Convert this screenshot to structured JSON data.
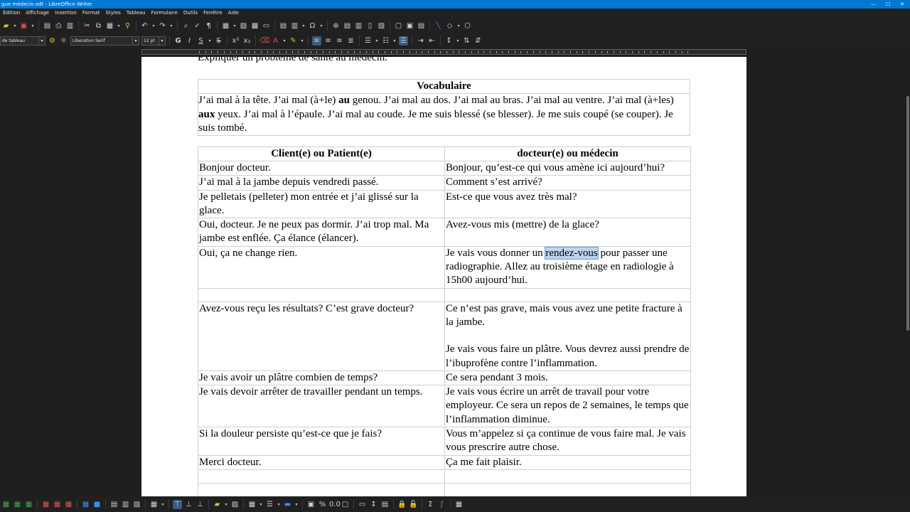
{
  "window": {
    "title": "gue médecin.odt - LibreOffice Writer",
    "controls": [
      "—",
      "☐",
      "✕"
    ]
  },
  "menu": [
    "Édition",
    "Affichage",
    "Insertion",
    "Format",
    "Styles",
    "Tableau",
    "Formulaire",
    "Outils",
    "Fenêtre",
    "Aide"
  ],
  "formatting": {
    "paragraph_style": "de tableau",
    "font_name": "Liberation Serif",
    "font_size": "12 pt",
    "bold": "G",
    "italic": "I",
    "underline": "S",
    "strike": "S"
  },
  "document": {
    "heading": "Expliquer un problème de santé au médecin.",
    "vocab": {
      "title": "Vocabulaire",
      "text_parts": [
        {
          "t": "J’ai mal à la tête. J’ai mal (à+le) ",
          "b": false
        },
        {
          "t": "au",
          "b": true
        },
        {
          "t": " genou. J’ai mal au dos. J’ai mal au bras. J’ai mal au ventre. J’ai mal (à+les) ",
          "b": false
        },
        {
          "t": "aux",
          "b": true
        },
        {
          "t": "  yeux. J’ai mal à l’épaule. J’ai mal au coude. Je me suis blessé (se blesser). Je me suis coupé  (se couper). Je suis tombé.",
          "b": false
        }
      ]
    },
    "dialog": {
      "col1_header": "Client(e)    ou    Patient(e)",
      "col2_header": "docteur(e)    ou    médecin",
      "rows": [
        {
          "left": "Bonjour docteur.",
          "right": "Bonjour, qu’est-ce qui vous amène ici aujourd’hui?"
        },
        {
          "left": "J’ai mal à la jambe depuis vendredi passé.",
          "right": "Comment s’est arrivé?"
        },
        {
          "left": "Je pelletais (pelleter) mon entrée et j’ai glissé sur la glace.",
          "right": "Est-ce que vous avez très mal?"
        },
        {
          "left": "Oui, docteur. Je ne peux pas dormir. J’ai trop mal. Ma jambe est enflée. Ça élance (élancer).",
          "right": "Avez-vous mis (mettre) de la glace?"
        },
        {
          "left": "Oui, ça ne change rien.",
          "right_pre": "Je vais vous donner un ",
          "right_sel": "rendez-vous",
          "right_post": " pour passer une radiographie. Allez au troisième étage en radiologie à 15h00 aujourd’hui."
        },
        {
          "left": "",
          "right": ""
        },
        {
          "left": "Avez-vous reçu les résultats? C’est grave docteur?",
          "right": "Ce n’est pas grave, mais vous avez une petite fracture à la jambe.",
          "right2": "Je vais vous faire un plâtre. Vous devrez aussi prendre de l’ibuprofène contre l’inflammation."
        },
        {
          "left": "Je vais avoir un plâtre combien de temps?",
          "right": "Ce sera pendant 3 mois."
        },
        {
          "left": "Je vais devoir arrêter de travailler pendant un temps.",
          "right": "Je vais vous écrire un arrêt de travail pour votre employeur. Ce sera un repos de 2 semaines, le temps que l’inflammation diminue."
        },
        {
          "left": "Si la douleur persiste qu’est-ce que je fais?",
          "right": "Vous m’appelez si ça continue de vous faire mal. Je vais vous prescrire autre chose."
        },
        {
          "left": "Merci docteur.",
          "right": "Ça me fait plaisir."
        },
        {
          "left": "",
          "right": ""
        },
        {
          "left": "",
          "right": ""
        }
      ]
    }
  },
  "colors": {
    "titlebar": "#0078d4",
    "chrome": "#202020",
    "selection": "#bcd4ee"
  }
}
